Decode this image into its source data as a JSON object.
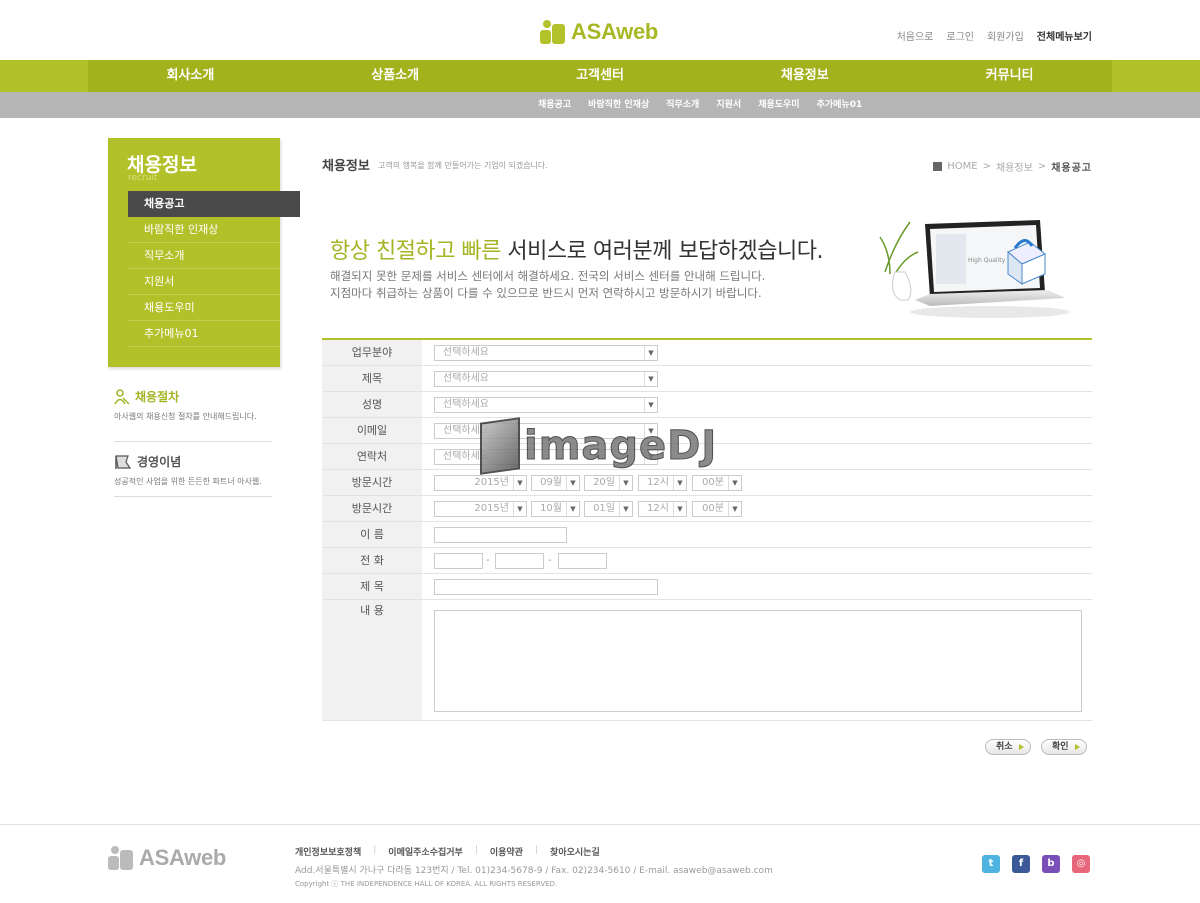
{
  "header": {
    "logo_text": "ASAweb",
    "top_links": [
      "처음으로",
      "로그인",
      "회원가입",
      "전체메뉴보기"
    ]
  },
  "gnb": [
    "회사소개",
    "상품소개",
    "고객센터",
    "채용정보",
    "커뮤니티"
  ],
  "subnav": [
    "채용공고",
    "바람직한 인재상",
    "직무소개",
    "지원서",
    "채용도우미",
    "추가메뉴01"
  ],
  "lnb": {
    "title": "채용정보",
    "subtitle": "recruit",
    "items": [
      "채용공고",
      "바람직한 인재상",
      "직무소개",
      "지원서",
      "채용도우미",
      "추가메뉴01"
    ]
  },
  "side": {
    "procedure_title": "채용절차",
    "procedure_desc": "아사웹의 채용신청 절차를 안내해드립니다.",
    "philosophy_title": "경영이념",
    "philosophy_desc": "성공적인 사업을 위한 든든한 파트너 아사웹."
  },
  "content": {
    "title": "채용정보",
    "desc": "고객의 행복을 함께 만들어가는 기업이 되겠습니다.",
    "breadcrumb": [
      "HOME",
      "채용정보",
      "채용공고"
    ]
  },
  "banner": {
    "headline_highlight": "항상 친절하고 빠른",
    "headline_rest": " 서비스로 여러분께 보답하겠습니다.",
    "line1": "해결되지 못한 문제를 서비스 센터에서 해결하세요. 전국의 서비스 센터를 안내해 드립니다.",
    "line2": "지점마다 취급하는 상품이 다를 수 있으므로 반드시 먼저 연락하시고 방문하시기 바랍니다.",
    "screen_text": "High Quality"
  },
  "form": {
    "labels": [
      "업무분야",
      "제목",
      "성명",
      "이메일",
      "연락처",
      "방문시간",
      "방문시간",
      "이 름",
      "전 화",
      "제 목",
      "내 용"
    ],
    "select_placeholder": "선택하세요",
    "visit1": [
      "2015년",
      "09월",
      "20일",
      "12시",
      "00분"
    ],
    "visit2": [
      "2015년",
      "10월",
      "01일",
      "12시",
      "00분"
    ],
    "phone_sep": "-"
  },
  "buttons": {
    "cancel": "취소",
    "confirm": "확인"
  },
  "watermark": "imageDJ",
  "footer": {
    "logo_text": "ASAweb",
    "links": [
      "개인정보보호정책",
      "이메일주소수집거부",
      "이용약관",
      "찾아오시는길"
    ],
    "address": "Add.서울특별시 가나구 다라동 123번지  / Tel. 01)234-5678-9  / Fax. 02)234-5610  / E-mail. asaweb@asaweb.com",
    "copyright": "Copyright ⓒ THE INDEPENDENCE HALL OF KOREA. ALL RIGHTS RESERVED."
  },
  "colors": {
    "accent": "#b2c12a",
    "accent_dark": "#a2b21d",
    "subnav": "#b5b5b5",
    "active_menu": "#4a4a4a"
  }
}
